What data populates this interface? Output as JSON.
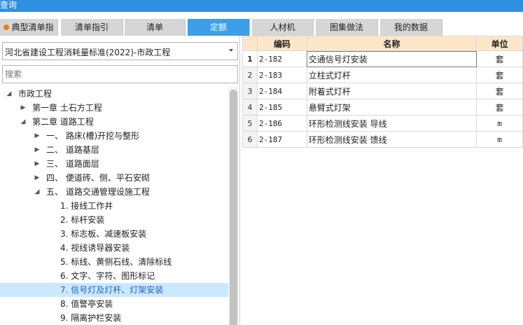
{
  "window": {
    "title": "查询"
  },
  "tabs": [
    {
      "label": "典型清单指引",
      "active": false
    },
    {
      "label": "清单指引",
      "active": false
    },
    {
      "label": "清单",
      "active": false
    },
    {
      "label": "定额",
      "active": true
    },
    {
      "label": "人材机",
      "active": false
    },
    {
      "label": "图集做法",
      "active": false
    },
    {
      "label": "我的数据",
      "active": false
    }
  ],
  "left": {
    "library_select": "河北省建设工程消耗量标准(2022)-市政工程",
    "search_placeholder": "搜索"
  },
  "tree": [
    {
      "label": "市政工程",
      "toggle": "◢",
      "level": 0
    },
    {
      "label": "第一章 土石方工程",
      "toggle": "▶",
      "level": 1
    },
    {
      "label": "第二章 道路工程",
      "toggle": "◢",
      "level": 1
    },
    {
      "label": "一、 路床(槽)开挖与整形",
      "toggle": "▶",
      "level": 2
    },
    {
      "label": "二、 道路基层",
      "toggle": "▶",
      "level": 2
    },
    {
      "label": "三、 道路面层",
      "toggle": "▶",
      "level": 2
    },
    {
      "label": "四、 便道砖、侧、平石安砌",
      "toggle": "▶",
      "level": 2
    },
    {
      "label": "五、 道路交通管理设施工程",
      "toggle": "◢",
      "level": 2
    },
    {
      "label": "1. 接线工作井",
      "toggle": "",
      "level": 3
    },
    {
      "label": "2. 标杆安装",
      "toggle": "",
      "level": 3
    },
    {
      "label": "3. 标志板、减速板安装",
      "toggle": "",
      "level": 3
    },
    {
      "label": "4. 视线诱导器安装",
      "toggle": "",
      "level": 3
    },
    {
      "label": "5. 标线、黄侧石线、清除标线",
      "toggle": "",
      "level": 3
    },
    {
      "label": "6. 文字、字符、图形标记",
      "toggle": "",
      "level": 3
    },
    {
      "label": "7. 信号灯及灯杆、灯架安装",
      "toggle": "",
      "level": 3,
      "selected": true
    },
    {
      "label": "8. 值警亭安装",
      "toggle": "",
      "level": 3
    },
    {
      "label": "9. 隔离护栏安装",
      "toggle": "",
      "level": 3
    }
  ],
  "grid": {
    "columns": [
      "编码",
      "名称",
      "单位"
    ],
    "rows": [
      {
        "no": "1",
        "code": "2-182",
        "name": "交通信号灯安装",
        "unit": "套"
      },
      {
        "no": "2",
        "code": "2-183",
        "name": "立柱式灯杆",
        "unit": "套"
      },
      {
        "no": "3",
        "code": "2-184",
        "name": "附着式灯杆",
        "unit": "套"
      },
      {
        "no": "4",
        "code": "2-185",
        "name": "悬臂式灯架",
        "unit": "套"
      },
      {
        "no": "5",
        "code": "2-186",
        "name": "环形检测线安装 导线",
        "unit": "m"
      },
      {
        "no": "6",
        "code": "2-187",
        "name": "环形检测线安装 馈线",
        "unit": "m"
      }
    ]
  },
  "colors": {
    "accent": "#3d9fe8",
    "header": "#fde6c8",
    "selection": "#cce8ff"
  }
}
